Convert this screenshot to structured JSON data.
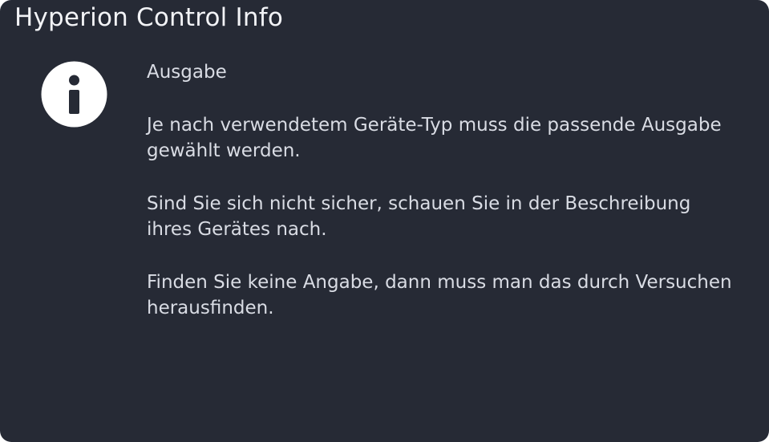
{
  "dialog": {
    "title": "Hyperion Control Info",
    "icon": "info-icon",
    "colors": {
      "background": "#262a35",
      "text": "#d9dce4",
      "icon_fill": "#ffffff",
      "icon_glyph": "#262a35"
    },
    "message": {
      "heading": "Ausgabe",
      "paragraphs": [
        "Je nach verwendetem Geräte-Typ muss die passende Ausgabe gewählt werden.",
        "Sind Sie sich nicht sicher, schauen Sie in der Beschreibung ihres Gerätes nach.",
        "Finden Sie keine Angabe, dann muss man das durch Versuchen herausfinden."
      ]
    }
  }
}
